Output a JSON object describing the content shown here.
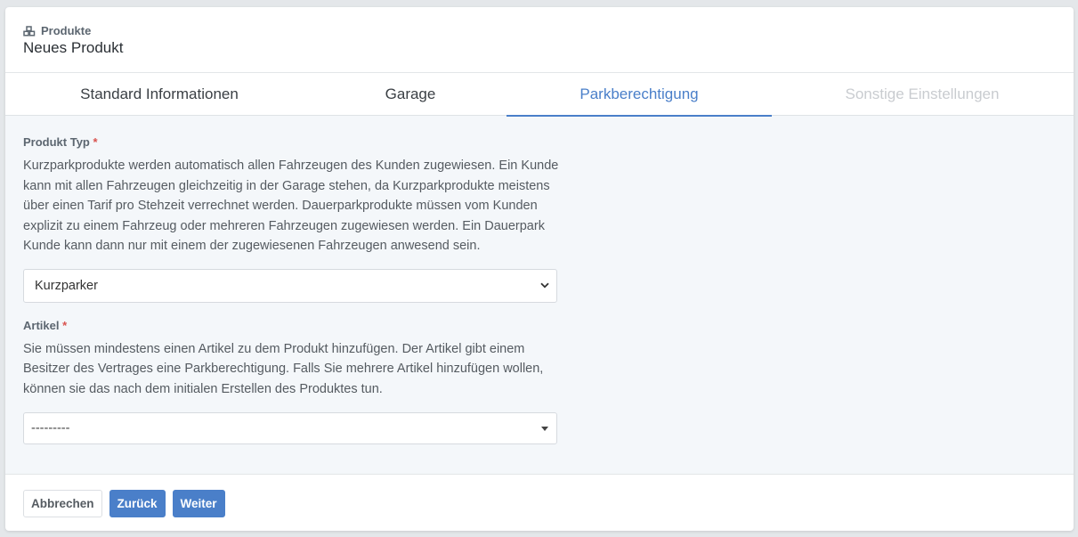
{
  "header": {
    "breadcrumb": "Produkte",
    "breadcrumb_icon": "cubes-icon",
    "title": "Neues Produkt"
  },
  "tabs": [
    {
      "label": "Standard Informationen",
      "state": "default"
    },
    {
      "label": "Garage",
      "state": "default"
    },
    {
      "label": "Parkberechtigung",
      "state": "active"
    },
    {
      "label": "Sonstige Einstellungen",
      "state": "disabled"
    }
  ],
  "form": {
    "product_type": {
      "label": "Produkt Typ",
      "required_mark": "*",
      "help": "Kurzparkprodukte werden automatisch allen Fahrzeugen des Kunden zugewiesen. Ein Kunde kann mit allen Fahrzeugen gleichzeitig in der Garage stehen, da Kurzparkprodukte meistens über einen Tarif pro Stehzeit verrechnet werden. Dauerparkprodukte müssen vom Kunden explizit zu einem Fahrzeug oder mehreren Fahrzeugen zugewiesen werden. Ein Dauerpark Kunde kann dann nur mit einem der zugewiesenen Fahrzeugen anwesend sein.",
      "value": "Kurzparker"
    },
    "article": {
      "label": "Artikel",
      "required_mark": "*",
      "help": "Sie müssen mindestens einen Artikel zu dem Produkt hinzufügen. Der Artikel gibt einem Besitzer des Vertrages eine Parkberechtigung. Falls Sie mehrere Artikel hinzufügen wollen, können sie das nach dem initialen Erstellen des Produktes tun.",
      "value": "---------"
    }
  },
  "footer": {
    "cancel_label": "Abbrechen",
    "back_label": "Zurück",
    "next_label": "Weiter"
  },
  "colors": {
    "accent": "#4a7fc9",
    "required": "#d9534f",
    "background": "#f4f7fa"
  }
}
